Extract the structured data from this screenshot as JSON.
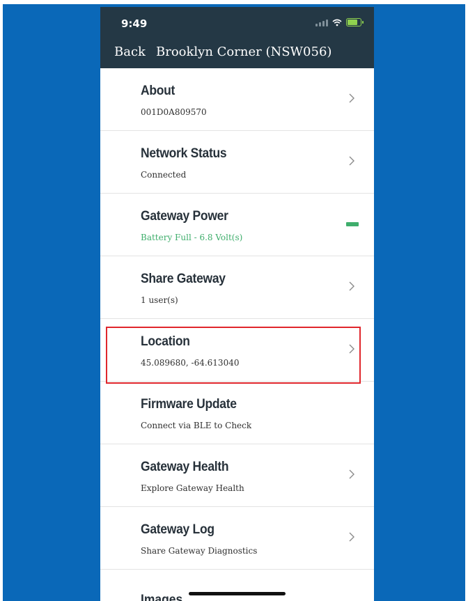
{
  "status_bar": {
    "time": "9:49",
    "icons": [
      "signal-icon",
      "wifi-icon",
      "battery-charging-icon"
    ]
  },
  "nav": {
    "back_label": "Back",
    "title": "Brooklyn Corner (NSW056)"
  },
  "items": [
    {
      "title": "About",
      "subtitle": "001D0A809570",
      "trailing": "chevron-right-icon"
    },
    {
      "title": "Network Status",
      "subtitle": "Connected",
      "trailing": "chevron-right-icon"
    },
    {
      "title": "Gateway Power",
      "subtitle": "Battery Full - 6.8 Volt(s)",
      "trailing": "battery-level-icon"
    },
    {
      "title": "Share Gateway",
      "subtitle": "1 user(s)",
      "trailing": "chevron-right-icon"
    },
    {
      "title": "Location",
      "subtitle": "45.089680, -64.613040",
      "trailing": "chevron-right-icon"
    },
    {
      "title": "Firmware Update",
      "subtitle": "Connect via BLE to Check",
      "trailing": ""
    },
    {
      "title": "Gateway Health",
      "subtitle": "Explore Gateway Health",
      "trailing": "chevron-right-icon"
    },
    {
      "title": "Gateway Log",
      "subtitle": "Share Gateway Diagnostics",
      "trailing": "chevron-right-icon"
    }
  ],
  "partial_item": {
    "title": "Images"
  },
  "colors": {
    "page_background": "#0a68b8",
    "header_background": "#243845",
    "status_green": "#3fae6c",
    "highlight_red": "#e0262c"
  }
}
